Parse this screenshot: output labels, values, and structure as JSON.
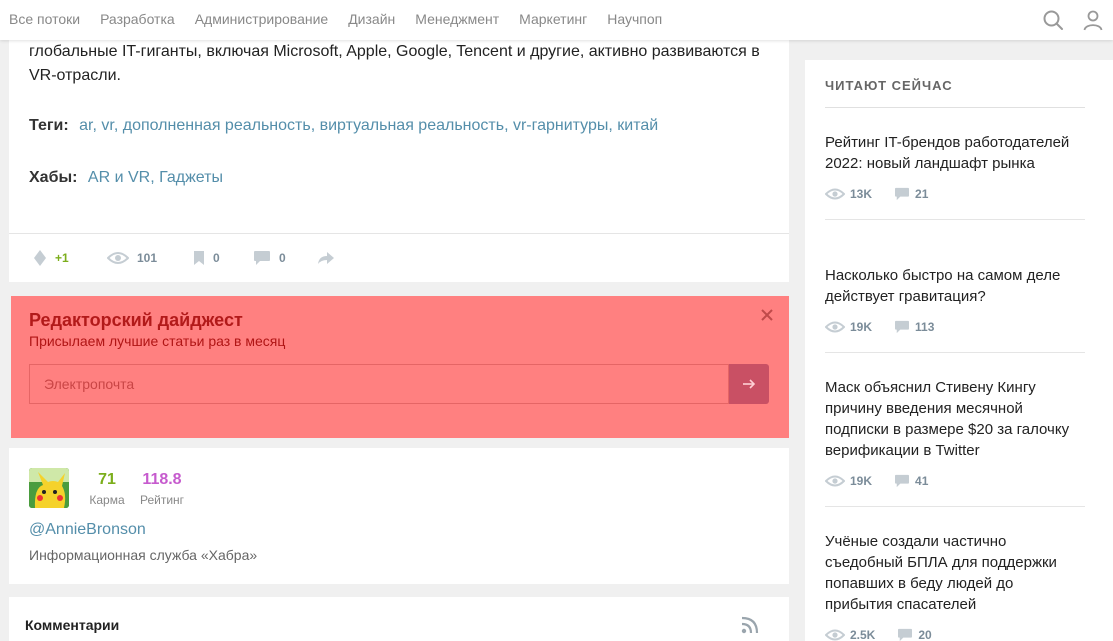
{
  "nav": {
    "items": [
      "Все потоки",
      "Разработка",
      "Администрирование",
      "Дизайн",
      "Менеджмент",
      "Маркетинг",
      "Научпоп"
    ]
  },
  "article": {
    "text": "глобальные IT-гиганты, включая Microsoft, Apple, Google, Tencent и другие, активно развиваются в VR-отрасли.",
    "tags_label": "Теги:",
    "tags": "ar, vr, дополненная реальность, виртуальная реальность, vr-гарнитуры, китай",
    "hubs_label": "Хабы:",
    "hubs": "AR и VR, Гаджеты",
    "stats": {
      "votes": "+1",
      "views": "101",
      "bookmarks": "0",
      "comments": "0"
    }
  },
  "digest": {
    "title": "Редакторский дайджест",
    "subtitle": "Присылаем лучшие статьи раз в месяц",
    "email_placeholder": "Электропочта",
    "email_value": ""
  },
  "author": {
    "karma": "71",
    "karma_label": "Карма",
    "rating": "118.8",
    "rating_label": "Рейтинг",
    "nick": "@AnnieBronson",
    "description": "Информационная служба «Хабра»"
  },
  "comments": {
    "title": "Комментарии"
  },
  "sidebar": {
    "heading": "ЧИТАЮТ СЕЙЧАС",
    "posts": [
      {
        "title": "Рейтинг IT-брендов работодателей 2022: новый ландшафт рынка",
        "views": "13K",
        "comments": "21"
      },
      {
        "title": "Насколько быстро на самом деле действует гравитация?",
        "views": "19K",
        "comments": "113"
      },
      {
        "title": "Маск объяснил Стивену Кингу причину введения месячной подписки в размере $20 за галочку верификации в Twitter",
        "views": "19K",
        "comments": "41"
      },
      {
        "title": "Учёные создали частично съедобный БПЛА для поддержки попавших в беду людей до прибытия спасателей",
        "views": "2.5K",
        "comments": "20"
      }
    ]
  },
  "colors": {
    "link": "#548eaa",
    "karma": "#7cae1c",
    "rating": "#c65bce",
    "digest_bg": "#ff8080",
    "digest_title": "#b21a1a"
  }
}
